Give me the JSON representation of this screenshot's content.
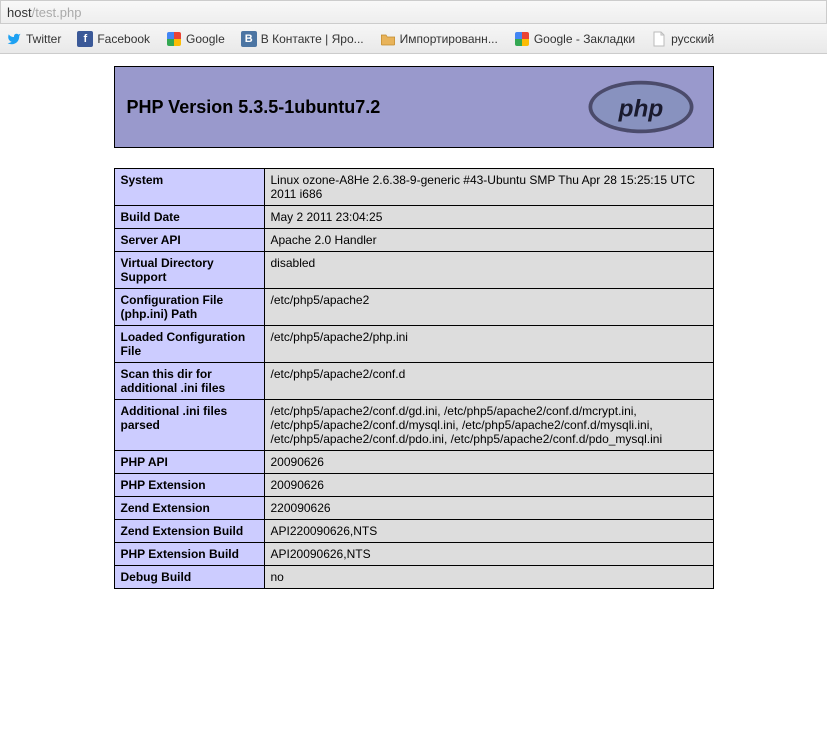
{
  "address": {
    "host": "host",
    "path": "/test.php"
  },
  "bookmarks": [
    {
      "label": "Twitter",
      "icon": "twitter"
    },
    {
      "label": "Facebook",
      "icon": "facebook"
    },
    {
      "label": "Google",
      "icon": "google"
    },
    {
      "label": "В Контакте | Яро...",
      "icon": "vk"
    },
    {
      "label": "Импортированн...",
      "icon": "folder"
    },
    {
      "label": "Google - Закладки",
      "icon": "google"
    },
    {
      "label": "русский",
      "icon": "page"
    }
  ],
  "phpinfo": {
    "title": "PHP Version 5.3.5-1ubuntu7.2",
    "logo_alt": "php",
    "rows": [
      {
        "key": "System",
        "value": "Linux ozone-A8He 2.6.38-9-generic #43-Ubuntu SMP Thu Apr 28 15:25:15 UTC 2011 i686"
      },
      {
        "key": "Build Date",
        "value": "May 2 2011 23:04:25"
      },
      {
        "key": "Server API",
        "value": "Apache 2.0 Handler"
      },
      {
        "key": "Virtual Directory Support",
        "value": "disabled"
      },
      {
        "key": "Configuration File (php.ini) Path",
        "value": "/etc/php5/apache2"
      },
      {
        "key": "Loaded Configuration File",
        "value": "/etc/php5/apache2/php.ini"
      },
      {
        "key": "Scan this dir for additional .ini files",
        "value": "/etc/php5/apache2/conf.d"
      },
      {
        "key": "Additional .ini files parsed",
        "value": "/etc/php5/apache2/conf.d/gd.ini, /etc/php5/apache2/conf.d/mcrypt.ini, /etc/php5/apache2/conf.d/mysql.ini, /etc/php5/apache2/conf.d/mysqli.ini, /etc/php5/apache2/conf.d/pdo.ini, /etc/php5/apache2/conf.d/pdo_mysql.ini"
      },
      {
        "key": "PHP API",
        "value": "20090626"
      },
      {
        "key": "PHP Extension",
        "value": "20090626"
      },
      {
        "key": "Zend Extension",
        "value": "220090626"
      },
      {
        "key": "Zend Extension Build",
        "value": "API220090626,NTS"
      },
      {
        "key": "PHP Extension Build",
        "value": "API20090626,NTS"
      },
      {
        "key": "Debug Build",
        "value": "no"
      }
    ]
  }
}
